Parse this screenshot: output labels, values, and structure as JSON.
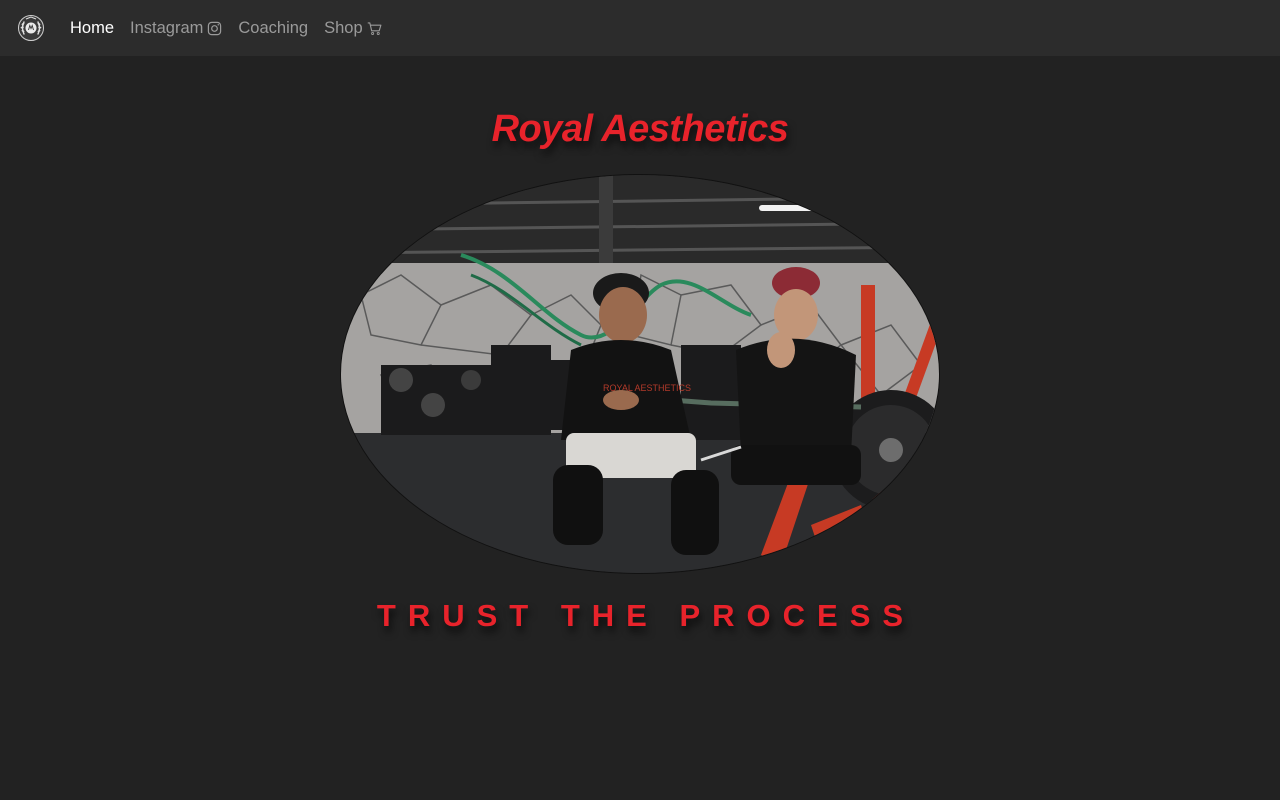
{
  "nav": {
    "brand_icon": "laurel-logo-icon",
    "items": [
      {
        "label": "Home",
        "active": true
      },
      {
        "label": "Instagram",
        "icon": "instagram-icon"
      },
      {
        "label": "Coaching"
      },
      {
        "label": "Shop",
        "icon": "cart-icon"
      }
    ]
  },
  "hero": {
    "title": "Royal Aesthetics",
    "image": "gym-training-photo",
    "tagline": "TRUST THE PROCESS"
  },
  "colors": {
    "background": "#222222",
    "navbar": "#2c2c2c",
    "accent": "#e8232b"
  }
}
